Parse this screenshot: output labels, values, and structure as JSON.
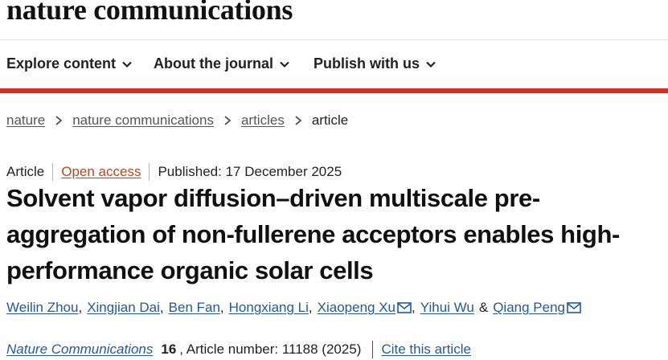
{
  "site": {
    "logo": "nature communications"
  },
  "nav": {
    "items": [
      {
        "label": "Explore content",
        "icon": "chevron-down-icon"
      },
      {
        "label": "About the journal",
        "icon": "chevron-down-icon"
      },
      {
        "label": "Publish with us",
        "icon": "chevron-down-icon"
      }
    ]
  },
  "colors": {
    "accent_red": "#e0291f",
    "link_blue": "#1f5a9e",
    "open_access_orange": "#b2491f"
  },
  "breadcrumb": {
    "items": [
      "nature",
      "nature communications",
      "articles"
    ],
    "current": "article"
  },
  "article": {
    "type": "Article",
    "access": "Open access",
    "published": "Published: 17 December 2025",
    "title": "Solvent vapor diffusion–driven multiscale pre-aggregation of non-fullerene acceptors enables high-performance organic solar cells",
    "authors": [
      "Weilin Zhou",
      "Xingjian Dai",
      "Ben Fan",
      "Hongxiang Li",
      "Xiaopeng Xu",
      "Yihui Wu",
      "Qiang Peng"
    ],
    "author_separator": ",",
    "author_and": "&",
    "journal": "Nature Communications",
    "volume": "16",
    "article_number": ", Article number: 11188 (2025)",
    "cite_label": "Cite this article"
  }
}
